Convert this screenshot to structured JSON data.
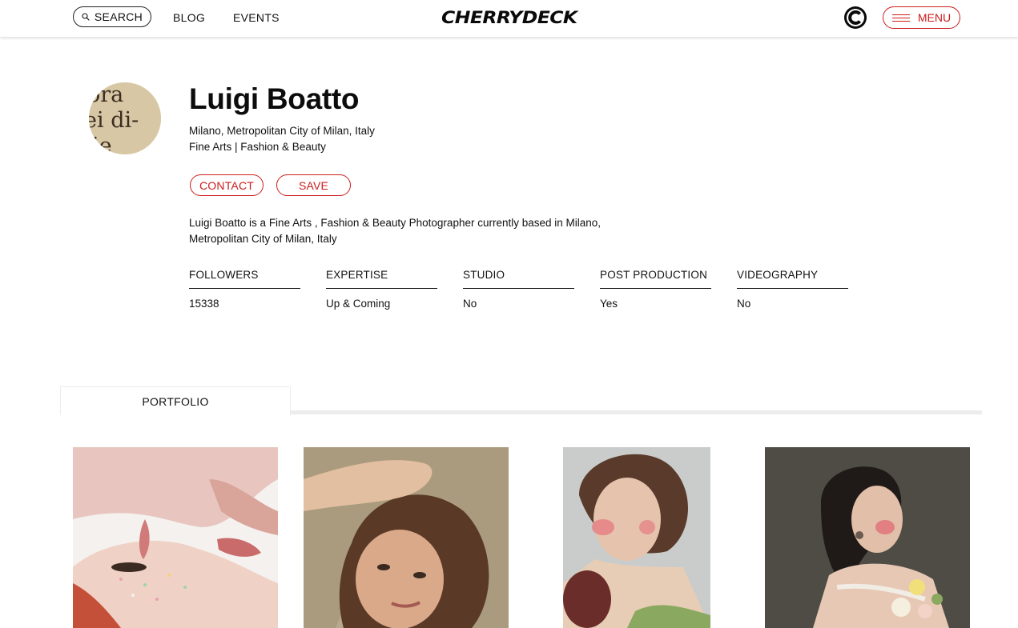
{
  "header": {
    "search_label": "SEARCH",
    "nav": [
      "BLOG",
      "EVENTS"
    ],
    "logo": "CHERRYDECK",
    "menu_label": "MENU"
  },
  "profile": {
    "name": "Luigi Boatto",
    "location": "Milano, Metropolitan City of Milan, Italy",
    "categories": "Fine Arts | Fashion & Beauty",
    "contact_label": "CONTACT",
    "save_label": "SAVE",
    "bio": "Luigi Boatto is a Fine Arts ,  Fashion & Beauty Photographer currently based in Milano, Metropolitan City of Milan, Italy",
    "avatar_text": "ora ei di- ie"
  },
  "stats": [
    {
      "label": "FOLLOWERS",
      "value": "15338"
    },
    {
      "label": "EXPERTISE",
      "value": "Up & Coming"
    },
    {
      "label": "STUDIO",
      "value": "No"
    },
    {
      "label": "POST PRODUCTION",
      "value": "Yes"
    },
    {
      "label": "VIDEOGRAPHY",
      "value": "No"
    }
  ],
  "tabs": {
    "portfolio_label": "PORTFOLIO"
  },
  "colors": {
    "accent": "#cc1b1b",
    "text": "#111111",
    "tab_bar": "#ededed"
  },
  "icons": {
    "search": "search-icon",
    "brand": "cherrydeck-c-icon",
    "menu": "hamburger-icon"
  }
}
